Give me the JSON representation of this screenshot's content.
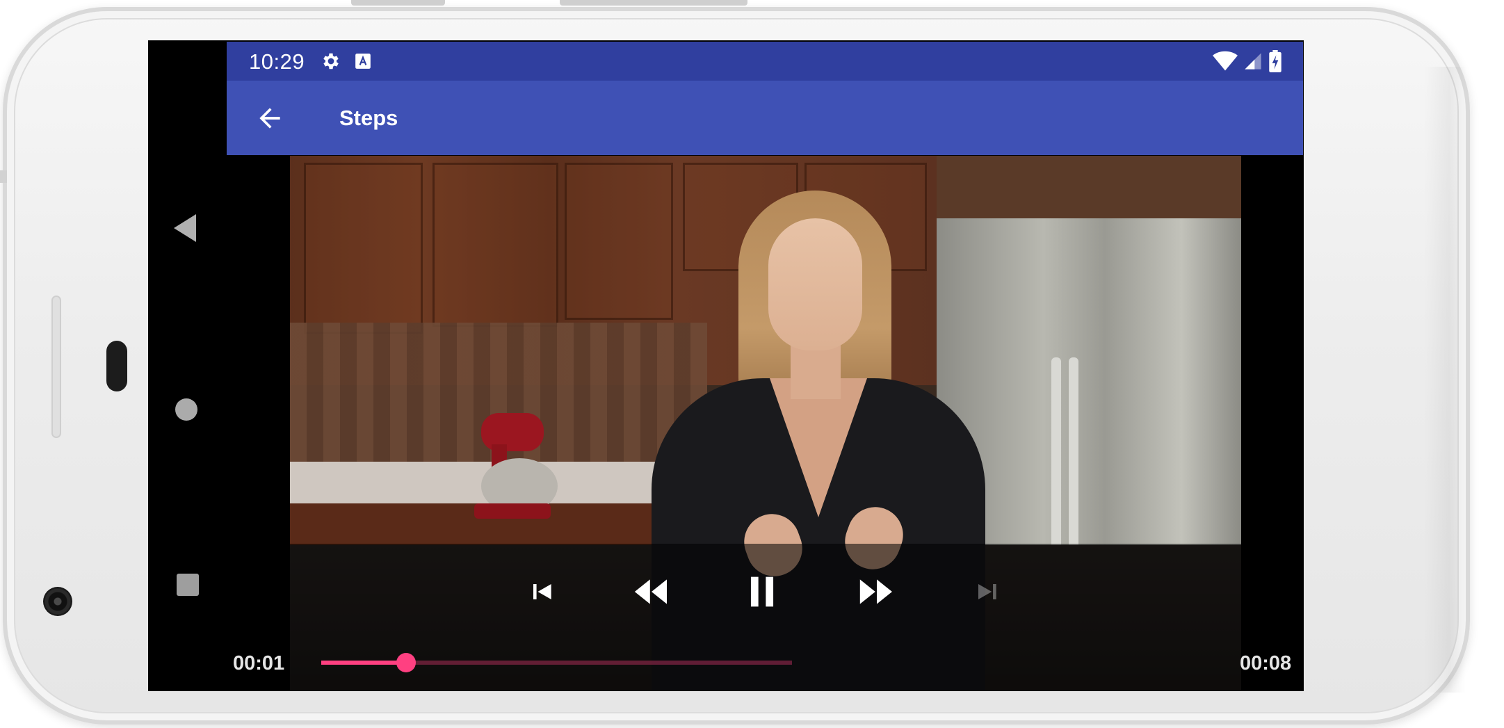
{
  "status_bar": {
    "time": "10:29",
    "left_icons": [
      "settings-icon",
      "keyboard-a-icon"
    ],
    "right_icons": [
      "wifi-icon",
      "cell-signal-icon",
      "battery-charging-icon"
    ]
  },
  "app_bar": {
    "title": "Steps",
    "nav_icon": "back-arrow-icon"
  },
  "player": {
    "current_time": "00:01",
    "duration": "00:08",
    "progress_fraction": 0.18,
    "controls": [
      "skip-previous-icon",
      "rewind-icon",
      "pause-icon",
      "fast-forward-icon",
      "skip-next-icon"
    ],
    "accent_color": "#ff4081"
  },
  "system_nav": [
    "nav-back-icon",
    "nav-home-icon",
    "nav-recents-icon"
  ],
  "colors": {
    "status_bar": "#303f9f",
    "app_bar": "#3f51b5"
  }
}
